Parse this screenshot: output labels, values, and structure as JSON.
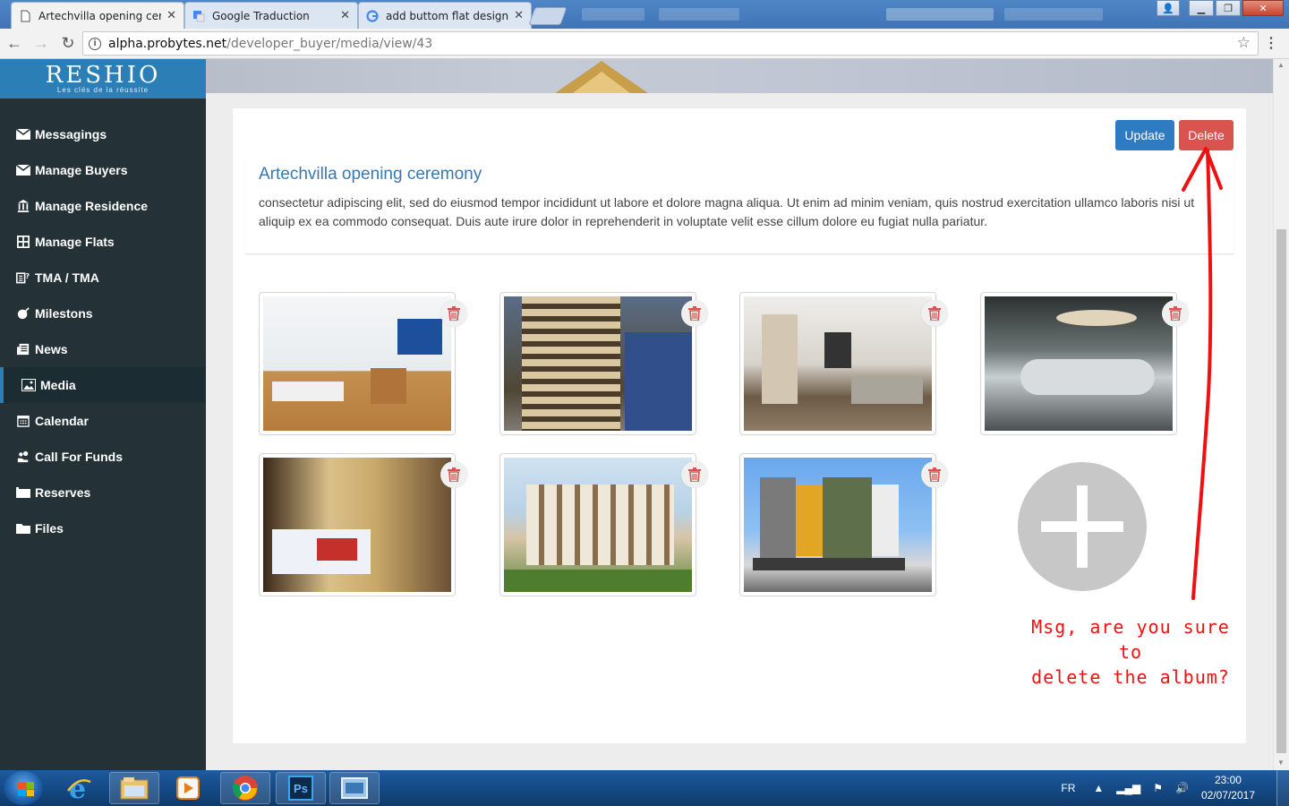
{
  "browser": {
    "tabs": [
      {
        "title": "Artechvilla opening cerem",
        "active": true,
        "icon": "document-icon"
      },
      {
        "title": "Google Traduction",
        "active": false,
        "icon": "google-translate-icon"
      },
      {
        "title": "add buttom flat design -",
        "active": false,
        "icon": "google-icon"
      }
    ],
    "url_host": "alpha.probytes.net",
    "url_path": "/developer_buyer/media/view/43"
  },
  "sidebar": {
    "logo": "RESHIO",
    "logo_tagline": "Les clés de la réussite",
    "items": [
      {
        "label": "Messagings",
        "icon": "envelope-icon",
        "active": false
      },
      {
        "label": "Manage Buyers",
        "icon": "envelope-icon",
        "active": false
      },
      {
        "label": "Manage Residence",
        "icon": "building-icon",
        "active": false
      },
      {
        "label": "Manage Flats",
        "icon": "grid-icon",
        "active": false
      },
      {
        "label": "TMA / TMA",
        "icon": "tma-icon",
        "active": false
      },
      {
        "label": "Milestons",
        "icon": "milestone-icon",
        "active": false
      },
      {
        "label": "News",
        "icon": "newspaper-icon",
        "active": false
      },
      {
        "label": "Media",
        "icon": "image-icon",
        "active": true
      },
      {
        "label": "Calendar",
        "icon": "calendar-icon",
        "active": false
      },
      {
        "label": "Call For Funds",
        "icon": "funds-icon",
        "active": false
      },
      {
        "label": "Reserves",
        "icon": "list-icon",
        "active": false
      },
      {
        "label": "Files",
        "icon": "folder-icon",
        "active": false
      }
    ]
  },
  "album": {
    "update_label": "Update",
    "delete_label": "Delete",
    "title": "Artechvilla opening ceremony",
    "description": "consectetur adipiscing elit, sed do eiusmod tempor incididunt ut labore et dolore magna aliqua. Ut enim ad minim veniam, quis nostrud exercitation ullamco laboris nisi ut aliquip ex ea commodo consequat. Duis aute irure dolor in reprehenderit in voluptate velit esse cillum dolore eu fugiat nulla pariatur.",
    "photos": [
      "bedroom-loft",
      "apartment-tower",
      "modern-living-room",
      "lounge-interior",
      "bedroom-wardrobe",
      "residential-building",
      "colorful-apartment-building"
    ]
  },
  "annotation": {
    "line1": "Msg, are you sure to",
    "line2": "delete the album?",
    "color": "#ee1111"
  },
  "colors": {
    "primary": "#2f7bc2",
    "danger": "#d9534f",
    "sidebar": "#243238",
    "brand": "#2c7eb7"
  },
  "taskbar": {
    "language": "FR",
    "time": "23:00",
    "date": "02/07/2017",
    "apps": [
      "internet-explorer-icon",
      "file-explorer-icon",
      "media-player-icon",
      "chrome-icon",
      "photoshop-icon",
      "screenshot-tool-icon"
    ]
  }
}
